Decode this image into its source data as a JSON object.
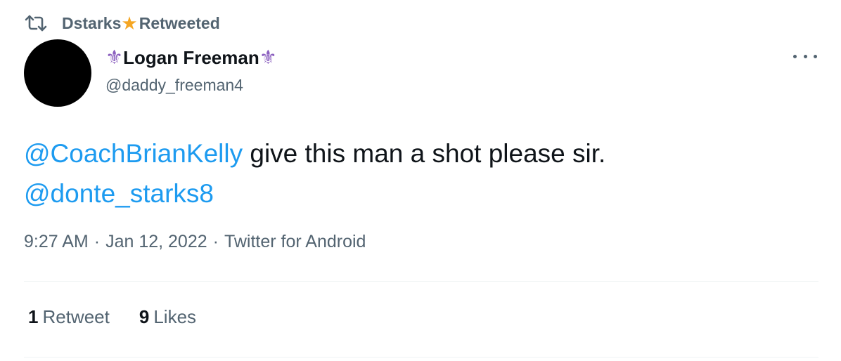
{
  "retweet_context": {
    "user": "Dstarks",
    "star_emoji": "★",
    "label": "Retweeted"
  },
  "author": {
    "name_prefix_emoji": "⚜",
    "name": "Logan Freeman",
    "name_suffix_emoji": "⚜",
    "handle": "@daddy_freeman4"
  },
  "tweet": {
    "mention_1": "@CoachBrianKelly",
    "text": " give this man a shot please sir.",
    "mention_2": "@donte_starks8"
  },
  "meta": {
    "time": "9:27 AM",
    "separator": "·",
    "date": "Jan 12, 2022",
    "source": "Twitter for Android"
  },
  "stats": {
    "retweets_count": "1",
    "retweets_label": "Retweet",
    "likes_count": "9",
    "likes_label": "Likes"
  },
  "colors": {
    "link": "#1d9bf0",
    "secondary_text": "#536471",
    "primary_text": "#0f1419",
    "star": "#f5a623",
    "fleur": "#8b5fbf"
  },
  "icons": {
    "retweet": "retweet-icon",
    "more": "more-options-icon"
  }
}
